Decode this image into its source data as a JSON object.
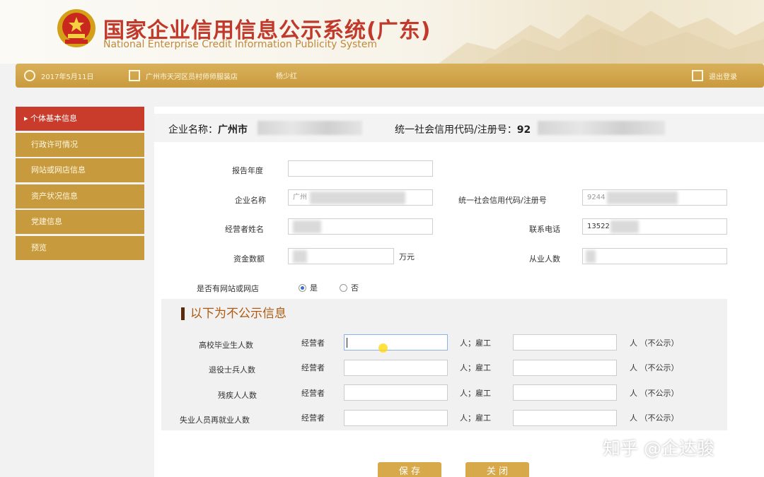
{
  "header": {
    "title_cn": "国家企业信用信息公示系统(广东)",
    "title_en": "National Enterprise Credit Information Publicity System",
    "emblem_icon": "national-emblem-icon"
  },
  "topbar": {
    "date": "2017年5月11日",
    "company": "广州市天河区员村师师服装店",
    "user": "杨少红",
    "logout": "退出登录"
  },
  "sidebar": {
    "items": [
      {
        "label": "▸ 个体基本信息",
        "active": true
      },
      {
        "label": "行政许可情况"
      },
      {
        "label": "网站或网店信息"
      },
      {
        "label": "资产状况信息"
      },
      {
        "label": "党建信息"
      },
      {
        "label": "预览"
      }
    ]
  },
  "info_bar": {
    "company_label": "企业名称：",
    "company_value": "广州市",
    "credit_label": "统一社会信用代码/注册号：",
    "credit_value": "92"
  },
  "form": {
    "report_year_label": "报告年度",
    "company_name_label": "企业名称",
    "company_name_value": "广州",
    "credit_code_label": "统一社会信用代码/注册号",
    "credit_code_value": "9244",
    "operator_label": "经营者姓名",
    "phone_label": "联系电话",
    "phone_value": "13522",
    "capital_label": "资金数额",
    "capital_unit": "万元",
    "employees_label": "从业人数",
    "website_label": "是否有网站或网店",
    "radio_yes": "是",
    "radio_no": "否"
  },
  "private_section": {
    "title": "以下为不公示信息",
    "operator_label": "经营者",
    "employee_label": "人；雇工",
    "unit_label": "人  （不公示）",
    "rows": [
      {
        "label": "高校毕业生人数"
      },
      {
        "label": "退役士兵人数"
      },
      {
        "label": "残疾人人数"
      },
      {
        "label": "失业人员再就业人数"
      }
    ]
  },
  "buttons": {
    "save": "保 存",
    "close": "关 闭"
  },
  "watermark": "知乎 @企达骏",
  "colors": {
    "title_red": "#c0392b",
    "gold": "#c99a3e",
    "active_red": "#c93b2b"
  }
}
